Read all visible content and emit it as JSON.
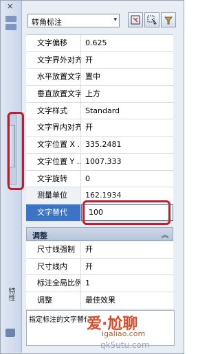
{
  "panel": {
    "close_glyph": "✕",
    "vertical_label": "特性",
    "selector": {
      "value": "转角标注",
      "arrow": "▾"
    }
  },
  "toolbar": {
    "buttons": [
      "quick-select-icon",
      "select-objects-icon",
      "toggle-pickadd-icon"
    ]
  },
  "properties": [
    {
      "label": "文字偏移",
      "value": "0.625"
    },
    {
      "label": "文字界外对齐",
      "value": "开"
    },
    {
      "label": "水平放置文字",
      "value": "置中"
    },
    {
      "label": "垂直放置文字",
      "value": "上方"
    },
    {
      "label": "文字样式",
      "value": "Standard"
    },
    {
      "label": "文字界内对齐",
      "value": "开"
    },
    {
      "label": "文字位置 X ...",
      "value": "335.2481"
    },
    {
      "label": "文字位置 Y ...",
      "value": "1007.333"
    },
    {
      "label": "文字旋转",
      "value": "0"
    },
    {
      "label": "测量单位",
      "value": "162.1934",
      "readonly": true
    },
    {
      "label": "文字替代",
      "value": "100",
      "selected": true
    }
  ],
  "section": {
    "title": "调整",
    "chevron": "︽"
  },
  "adjust_properties": [
    {
      "label": "尺寸线强制",
      "value": "开"
    },
    {
      "label": "尺寸线内",
      "value": "开"
    },
    {
      "label": "标注全局比例",
      "value": "1"
    },
    {
      "label": "调整",
      "value": "最佳效果"
    }
  ],
  "description": "指定标注的文字替代",
  "watermark": {
    "main": "爱",
    "brand": "尬聊",
    "url": "igaliao.com",
    "ghost": "qk5utu.com"
  },
  "colors": {
    "highlight": "#c21b2d",
    "selected_row": "#3b74c6"
  }
}
